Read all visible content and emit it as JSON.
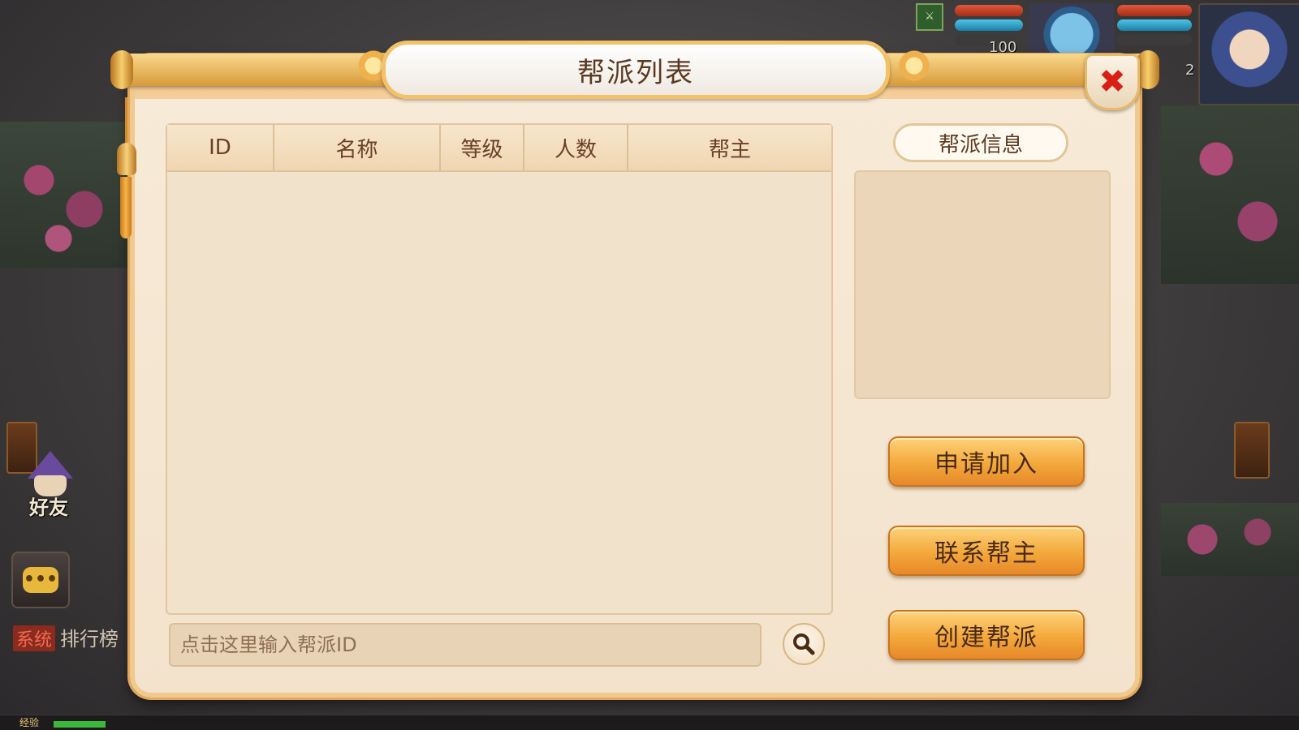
{
  "dialog": {
    "title": "帮派列表",
    "close_icon": "close-icon"
  },
  "table": {
    "headers": [
      "ID",
      "名称",
      "等级",
      "人数",
      "帮主"
    ],
    "rows": []
  },
  "search": {
    "placeholder": "点击这里输入帮派ID",
    "value": "",
    "icon": "search-icon"
  },
  "info_panel": {
    "title": "帮派信息"
  },
  "actions": {
    "apply": "申请加入",
    "contact": "联系帮主",
    "create": "创建帮派"
  },
  "hud": {
    "pet_level": "100",
    "hero_level": "2",
    "friend_label": "好友",
    "chat_tag": "系统",
    "chat_text": "排行榜",
    "xp_label": "经验"
  },
  "colors": {
    "accent_orange": "#f3a83b",
    "panel_bg": "#f3e3cd",
    "close_red": "#d91e14",
    "title_text": "#5b3a22"
  }
}
